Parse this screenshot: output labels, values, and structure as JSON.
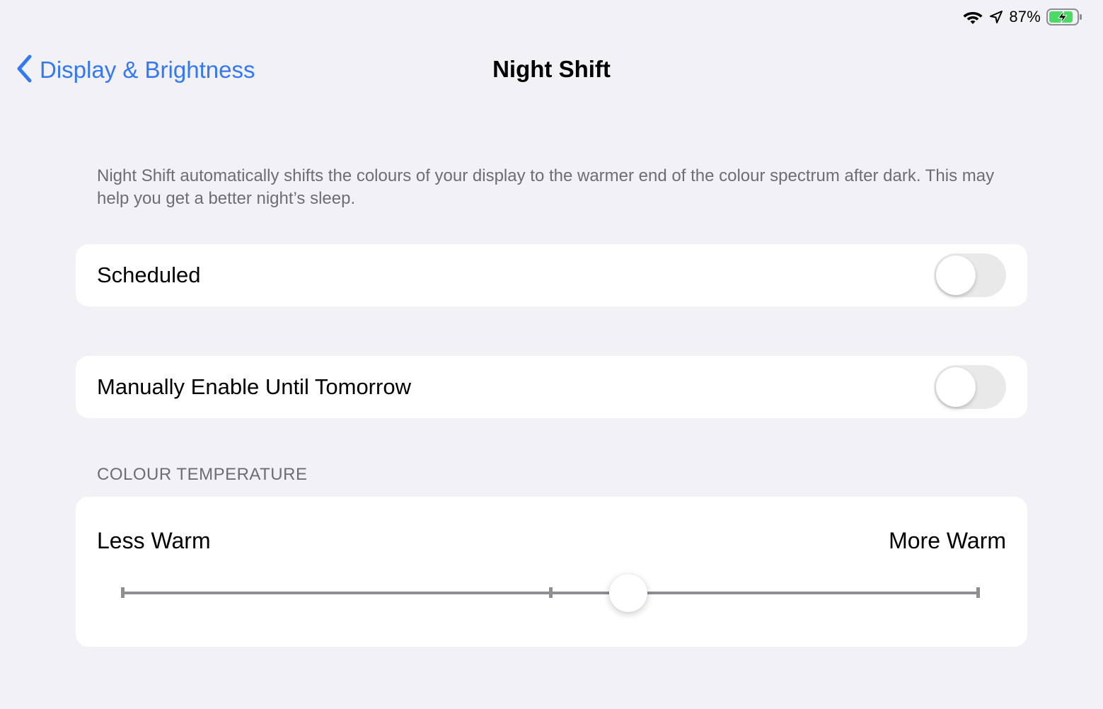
{
  "status_bar": {
    "battery_percent": "87%",
    "battery_level": 0.87,
    "charging": true,
    "icons": [
      "wifi-icon",
      "location-arrow-icon",
      "battery-charging-icon"
    ]
  },
  "nav": {
    "back_label": "Display & Brightness",
    "title": "Night Shift"
  },
  "description": "Night Shift automatically shifts the colours of your display to the warmer end of the colour spectrum after dark. This may help you get a better night’s sleep.",
  "settings": {
    "scheduled": {
      "label": "Scheduled",
      "on": false
    },
    "manual": {
      "label": "Manually Enable Until Tomorrow",
      "on": false
    }
  },
  "colour_temperature": {
    "header": "COLOUR TEMPERATURE",
    "min_label": "Less Warm",
    "max_label": "More Warm",
    "value": 0.59
  },
  "colors": {
    "accent": "#3478f6",
    "background": "#f1f1f6",
    "battery_fill": "#4cd964"
  }
}
